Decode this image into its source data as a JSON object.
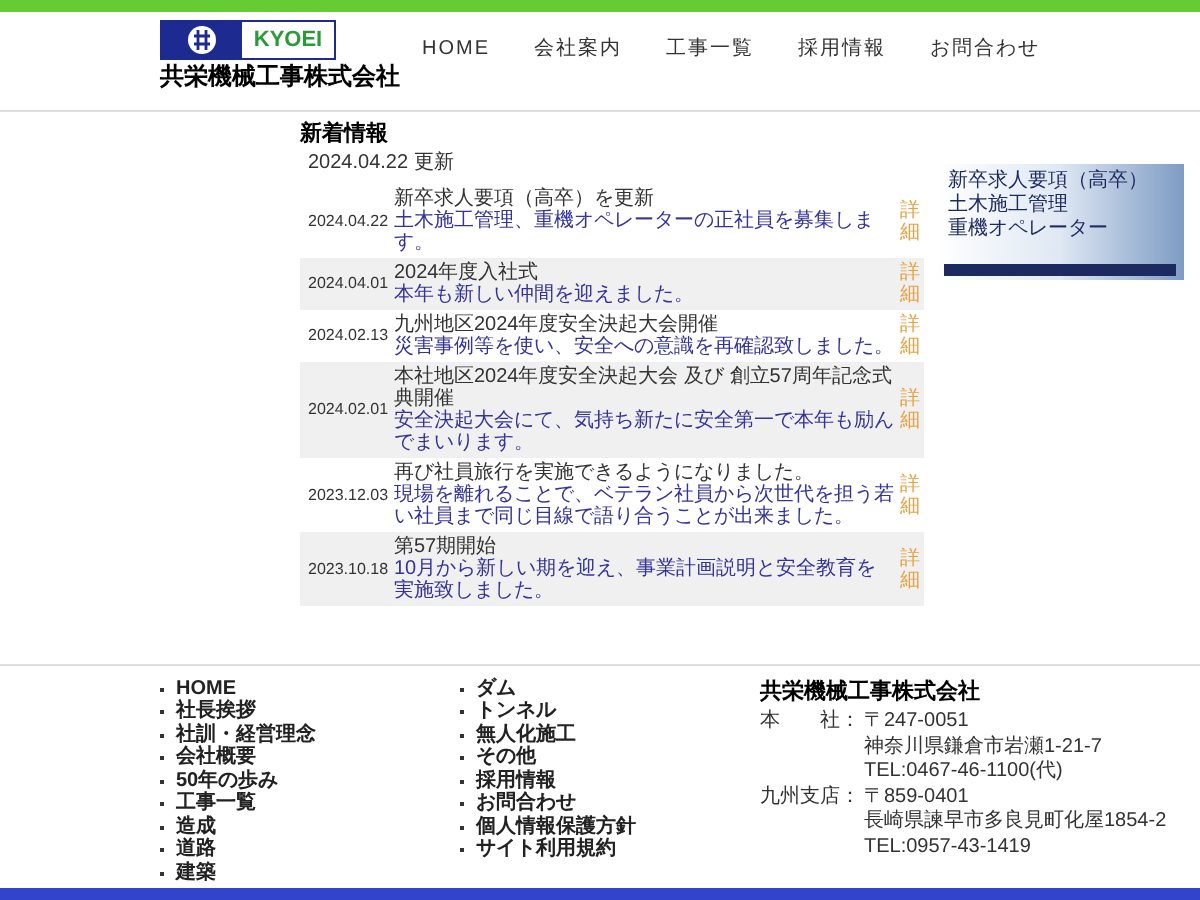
{
  "header": {
    "logo_text": "KYOEI",
    "company_name": "共栄機械工事株式会社"
  },
  "nav": [
    "HOME",
    "会社案内",
    "工事一覧",
    "採用情報",
    "お問合わせ"
  ],
  "news": {
    "heading": "新着情報",
    "updated": "2024.04.22 更新",
    "items": [
      {
        "date": "2024.04.22",
        "title": "新卒求人要項（高卒）を更新",
        "text": "土木施工管理、重機オペレーターの正社員を募集します。",
        "more_label": "詳細"
      },
      {
        "date": "2024.04.01",
        "title": "2024年度入社式",
        "text": "本年も新しい仲間を迎えました。",
        "more_label": "詳細"
      },
      {
        "date": "2024.02.13",
        "title": "九州地区2024年度安全決起大会開催",
        "text": "災害事例等を使い、安全への意識を再確認致しました。",
        "more_label": "詳細"
      },
      {
        "date": "2024.02.01",
        "title": "本社地区2024年度安全決起大会 及び 創立57周年記念式典開催",
        "text": "安全決起大会にて、気持ち新たに安全第一で本年も励んでまいります。",
        "more_label": "詳細"
      },
      {
        "date": "2023.12.03",
        "title": "再び社員旅行を実施できるようになりました。",
        "text": "現場を離れることで、ベテラン社員から次世代を担う若い社員まで同じ目線で語り合うことが出来ました。",
        "more_label": "詳細"
      },
      {
        "date": "2023.10.18",
        "title": "第57期開始",
        "text": "10月から新しい期を迎え、事業計画説明と安全教育を実施致しました。",
        "more_label": "詳細"
      }
    ]
  },
  "banner": {
    "lines": [
      "新卒求人要項（高卒）",
      "土木施工管理",
      "重機オペレーター"
    ]
  },
  "footer": {
    "links_left": [
      "HOME",
      "社長挨拶",
      "社訓・経営理念",
      "会社概要",
      "50年の歩み",
      "工事一覧",
      "造成",
      "道路",
      "建築"
    ],
    "links_right": [
      "ダム",
      "トンネル",
      "無人化施工",
      "その他",
      "採用情報",
      "お問合わせ",
      "個人情報保護方針",
      "サイト利用規約"
    ],
    "company_name": "共栄機械工事株式会社",
    "offices": [
      {
        "label": "本　　社：",
        "lines": [
          "〒247-0051",
          "神奈川県鎌倉市岩瀬1-21-7",
          "TEL:0467-46-1100(代)"
        ]
      },
      {
        "label": "九州支店：",
        "lines": [
          "〒859-0401",
          "長崎県諫早市多良見町化屋1854-2",
          "TEL:0957-43-1419"
        ]
      }
    ]
  }
}
